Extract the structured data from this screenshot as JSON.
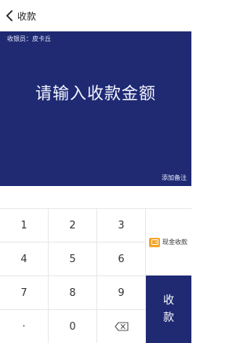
{
  "header": {
    "title": "收款"
  },
  "panel": {
    "cashier_label": "收银员：",
    "cashier_name": "皮卡丘",
    "prompt": "请输入收款金额",
    "remark": "添加备注"
  },
  "keypad": {
    "keys": [
      "1",
      "2",
      "3",
      "4",
      "5",
      "6",
      "7",
      "8",
      "9",
      "·",
      "0"
    ],
    "backspace_icon": "backspace-icon"
  },
  "side": {
    "cash_label": "现金收款",
    "cash_icon": "wallet-icon",
    "collect_label": "收款"
  },
  "colors": {
    "accent": "#1f2a73",
    "cash_icon": "#f3a527"
  }
}
